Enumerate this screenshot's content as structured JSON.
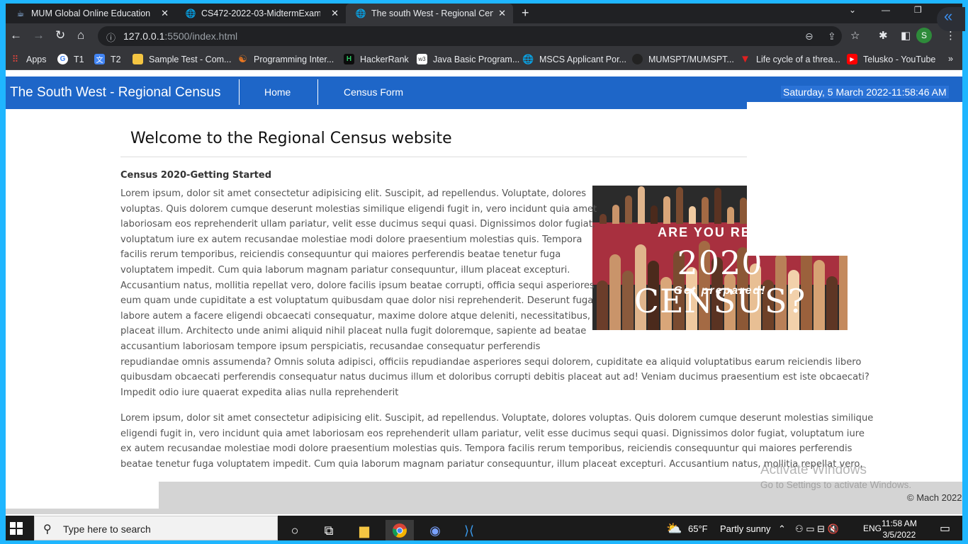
{
  "browser": {
    "tabs": [
      {
        "title": "MUM Global Online Education :: C",
        "icon": "java-cup-icon"
      },
      {
        "title": "CS472-2022-03-MidtermExam",
        "icon": "globe-icon"
      },
      {
        "title": "The south West - Regional Census",
        "icon": "globe-icon"
      }
    ],
    "url_host": "127.0.0.1",
    "url_path": ":5500/index.html",
    "profile_initial": "S",
    "bookmarks": [
      {
        "label": "Apps",
        "icon": "apps-grid-icon",
        "color": "#e8453c"
      },
      {
        "label": "T1",
        "icon": "google-icon",
        "color": "#ffffff"
      },
      {
        "label": "T2",
        "icon": "translate-icon",
        "color": "#4285f4"
      },
      {
        "label": "Sample Test - Com...",
        "icon": "doc-icon",
        "color": "#f4c542"
      },
      {
        "label": "Programming Inter...",
        "icon": "swirl-icon",
        "color": "#e87722"
      },
      {
        "label": "HackerRank",
        "icon": "hackerrank-icon",
        "color": "#000000"
      },
      {
        "label": "Java Basic Program...",
        "icon": "w3-icon",
        "color": "#ffffff"
      },
      {
        "label": "MSCS Applicant Por...",
        "icon": "globe-icon",
        "color": "#ffffff"
      },
      {
        "label": "MUMSPT/MUMSPT...",
        "icon": "github-icon",
        "color": "#222222"
      },
      {
        "label": "Life cycle of a threa...",
        "icon": "triangle-icon",
        "color": "#e02020"
      },
      {
        "label": "Telusko - YouTube",
        "icon": "youtube-icon",
        "color": "#ff0000"
      }
    ],
    "more_bookmarks": "»"
  },
  "site": {
    "brand": "The South West - Regional Census",
    "nav": [
      "Home",
      "Census Form"
    ],
    "datetime": "Saturday, 5 March 2022-11:58:46 AM",
    "page_title": "Welcome to the Regional Census website",
    "subheading": "Census 2020-Getting Started",
    "image": {
      "line1": "ARE YOU READY",
      "line2": "2020 CENSUS?",
      "line3": "Get prepared!"
    },
    "para1_lines": [
      "Lorem ipsum, dolor sit amet consectetur adipisicing elit. Suscipit, ad repellendus. Voluptate, dolores",
      "voluptas. Quis dolorem cumque deserunt molestias similique eligendi fugit in, vero incidunt quia amet",
      "laboriosam eos reprehenderit ullam pariatur, velit esse ducimus sequi quasi. Dignissimos dolor fugiat,",
      "voluptatum iure ex autem recusandae molestiae modi dolore praesentium molestias quis. Tempora",
      "facilis rerum temporibus, reiciendis consequuntur qui maiores perferendis beatae tenetur fuga",
      "voluptatem impedit. Cum quia laborum magnam pariatur consequuntur, illum placeat excepturi.",
      "Accusantium natus, mollitia repellat vero, dolore facilis ipsum beatae corrupti, officia sequi asperiores",
      "eum quam unde cupiditate a est voluptatum quibusdam quae dolor nisi reprehenderit. Deserunt fuga",
      "labore autem a facere eligendi obcaecati consequatur, maxime dolore atque deleniti, necessitatibus,",
      "placeat illum. Architecto unde animi aliquid nihil placeat nulla fugit doloremque, sapiente ad beatae",
      "accusantium laboriosam tempore ipsum perspiciatis, recusandae consequatur perferendis",
      "repudiandae omnis assumenda? Omnis soluta adipisci, officiis repudiandae asperiores sequi dolorem, cupiditate ea aliquid voluptatibus earum reiciendis libero",
      "quibusdam obcaecati perferendis consequatur natus ducimus illum et doloribus corrupti debitis placeat aut ad! Veniam ducimus praesentium est iste obcaecati?",
      "Impedit odio iure quaerat expedita alias nulla reprehenderit"
    ],
    "para2_lines": [
      "Lorem ipsum, dolor sit amet consectetur adipisicing elit. Suscipit, ad repellendus. Voluptate, dolores voluptas. Quis dolorem cumque deserunt molestias similique",
      "eligendi fugit in, vero incidunt quia amet laboriosam eos reprehenderit ullam pariatur, velit esse ducimus sequi quasi. Dignissimos dolor fugiat, voluptatum iure",
      "ex autem recusandae molestiae modi dolore praesentium molestias quis. Tempora facilis rerum temporibus, reiciendis consequuntur qui maiores perferendis",
      "beatae tenetur fuga voluptatem impedit. Cum quia laborum magnam pariatur consequuntur, illum placeat excepturi. Accusantium natus, mollitia repellat vero,"
    ],
    "copyright": "© Mach 2022"
  },
  "watermark": {
    "title": "Activate Windows",
    "subtitle": "Go to Settings to activate Windows."
  },
  "taskbar": {
    "search_placeholder": "Type here to search",
    "weather_temp": "65°F",
    "weather_desc": "Partly sunny",
    "language": "ENG",
    "time": "11:58 AM",
    "date": "3/5/2022"
  }
}
